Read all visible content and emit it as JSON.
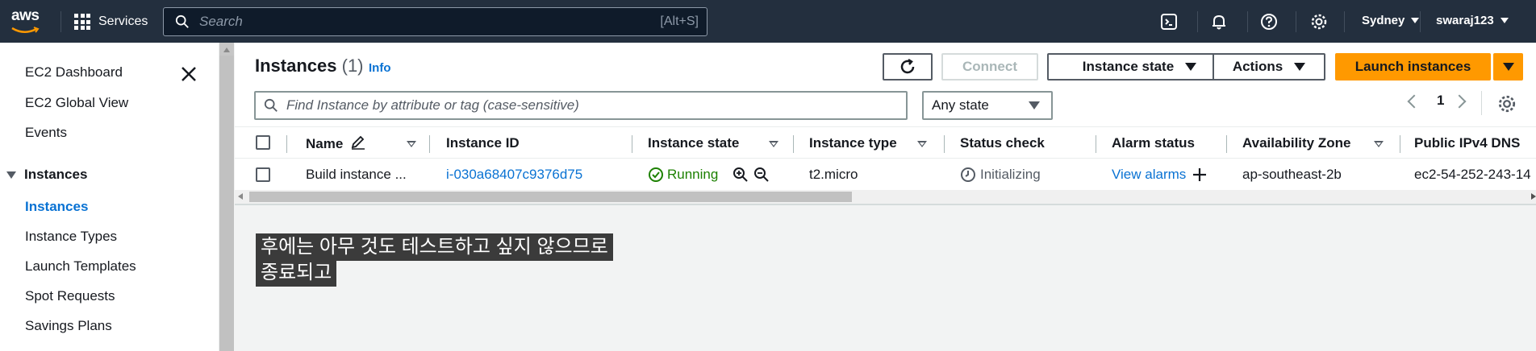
{
  "topnav": {
    "logo": "aws",
    "services_label": "Services",
    "search_placeholder": "Search",
    "search_shortcut": "[Alt+S]",
    "region": "Sydney",
    "account": "swaraj123",
    "icons": [
      "cloudshell-icon",
      "bell-icon",
      "help-icon",
      "settings-icon"
    ]
  },
  "sidebar": {
    "items_top": [
      "EC2 Dashboard",
      "EC2 Global View",
      "Events"
    ],
    "section_label": "Instances",
    "section_items": [
      {
        "label": "Instances",
        "active": true
      },
      {
        "label": "Instance Types",
        "active": false
      },
      {
        "label": "Launch Templates",
        "active": false
      },
      {
        "label": "Spot Requests",
        "active": false
      },
      {
        "label": "Savings Plans",
        "active": false
      }
    ]
  },
  "header": {
    "title": "Instances",
    "count": "(1)",
    "info": "Info",
    "refresh_icon": "refresh-icon",
    "connect_label": "Connect",
    "instance_state_label": "Instance state",
    "actions_label": "Actions",
    "launch_label": "Launch instances"
  },
  "filter": {
    "placeholder": "Find Instance by attribute or tag (case-sensitive)",
    "state_select": "Any state",
    "page": "1"
  },
  "table": {
    "columns": [
      "Name",
      "Instance ID",
      "Instance state",
      "Instance type",
      "Status check",
      "Alarm status",
      "Availability Zone",
      "Public IPv4 DNS"
    ],
    "rows": [
      {
        "name": "Build instance ...",
        "instance_id": "i-030a68407c9376d75",
        "state": "Running",
        "type": "t2.micro",
        "status_check": "Initializing",
        "alarm": "View alarms",
        "az": "ap-southeast-2b",
        "dns": "ec2-54-252-243-14"
      }
    ]
  },
  "caption": {
    "line1": "후에는 아무 것도 테스트하고 싶지 않으므로",
    "line2": "종료되고"
  },
  "colors": {
    "nav_bg": "#232f3e",
    "link": "#0972d3",
    "running_green": "#1d8102",
    "launch_orange": "#ff9900"
  }
}
